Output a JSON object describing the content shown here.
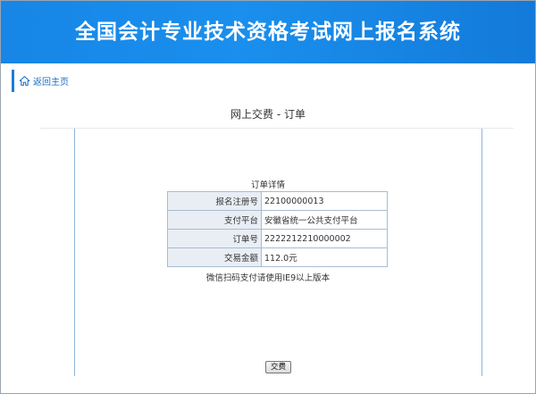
{
  "header": {
    "title": "全国会计专业技术资格考试网上报名系统"
  },
  "nav": {
    "home_label": "返回主页",
    "home_icon": "home-icon"
  },
  "page": {
    "title": "网上交费 - 订单"
  },
  "order": {
    "caption": "订单详情",
    "rows": [
      {
        "label": "报名注册号",
        "value": "22100000013"
      },
      {
        "label": "支付平台",
        "value": "安徽省统一公共支付平台"
      },
      {
        "label": "订单号",
        "value": "2222212210000002"
      },
      {
        "label": "交易金额",
        "value": "112.0元"
      }
    ],
    "note": "微信扫码支付请使用IE9以上版本"
  },
  "actions": {
    "pay_label": "交费"
  },
  "colors": {
    "header": "#1a8fed",
    "accent": "#1a7fd8",
    "label_bg": "#e9eef5"
  }
}
